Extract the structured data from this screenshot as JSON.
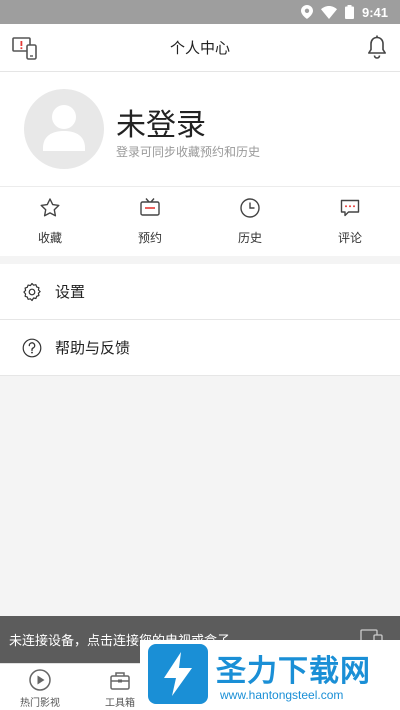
{
  "status_bar": {
    "time": "9:41"
  },
  "header": {
    "title": "个人中心"
  },
  "profile": {
    "name": "未登录",
    "subtitle": "登录可同步收藏预约和历史"
  },
  "quick_actions": [
    {
      "label": "收藏",
      "icon": "star-icon"
    },
    {
      "label": "预约",
      "icon": "tv-icon"
    },
    {
      "label": "历史",
      "icon": "clock-icon"
    },
    {
      "label": "评论",
      "icon": "comment-icon"
    }
  ],
  "menu": [
    {
      "label": "设置",
      "icon": "gear-icon"
    },
    {
      "label": "帮助与反馈",
      "icon": "help-icon"
    }
  ],
  "banner": {
    "text": "未连接设备，点击连接您的电视或盒子"
  },
  "bottom_nav": [
    {
      "label": "热门影视",
      "icon": "play-circle-icon"
    },
    {
      "label": "工具箱",
      "icon": "toolbox-icon"
    }
  ],
  "watermark": {
    "title": "圣力下载网",
    "url": "www.hantongsteel.com"
  },
  "colors": {
    "accent": "#1a8fd6",
    "banner_bg": "#5c5c5c",
    "alert_red": "#e53935"
  }
}
